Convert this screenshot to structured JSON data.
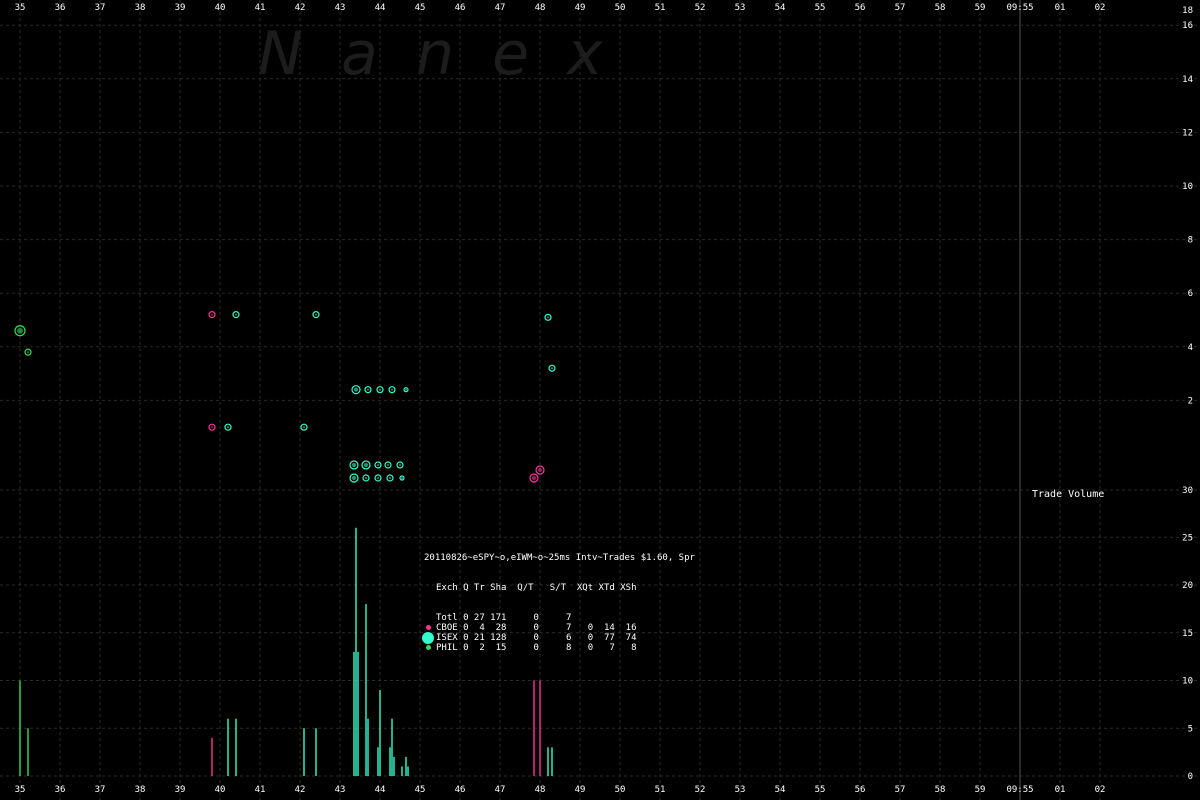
{
  "chart_data": {
    "type": "scatter",
    "watermark": "N  a  n  e  x",
    "x_ticks": [
      "35",
      "36",
      "37",
      "38",
      "39",
      "40",
      "41",
      "42",
      "43",
      "44",
      "45",
      "46",
      "47",
      "48",
      "49",
      "50",
      "51",
      "52",
      "53",
      "54",
      "55",
      "56",
      "57",
      "58",
      "59",
      "09:55",
      "01",
      "02"
    ],
    "marker_x_tick": "09:55",
    "price_panel": {
      "y_ticks": [
        "18",
        "16",
        "14",
        "12",
        "10",
        "8",
        "6",
        "4",
        "2",
        "30"
      ],
      "ylim": [
        30,
        18
      ]
    },
    "volume_panel": {
      "label": "Trade Volume",
      "y_ticks": [
        "30",
        "25",
        "20",
        "15",
        "10",
        "5",
        "0"
      ],
      "ylim": [
        0,
        30
      ]
    },
    "exchanges": [
      {
        "code": "CBOE",
        "color": "#ff3399"
      },
      {
        "code": "ISEX",
        "color": "#33ffcc"
      },
      {
        "code": "PHIL",
        "color": "#33dd55"
      }
    ],
    "trades": [
      {
        "x": 35.0,
        "y": 4.6,
        "ex": "PHIL",
        "size": 5
      },
      {
        "x": 35.2,
        "y": 3.8,
        "ex": "PHIL",
        "size": 3
      },
      {
        "x": 39.8,
        "y": 5.2,
        "ex": "CBOE",
        "size": 3
      },
      {
        "x": 39.8,
        "y": 1.0,
        "ex": "CBOE",
        "size": 3
      },
      {
        "x": 40.2,
        "y": 1.0,
        "ex": "ISEX",
        "size": 3
      },
      {
        "x": 40.4,
        "y": 5.2,
        "ex": "ISEX",
        "size": 3
      },
      {
        "x": 42.1,
        "y": 1.0,
        "ex": "ISEX",
        "size": 3
      },
      {
        "x": 42.4,
        "y": 5.2,
        "ex": "ISEX",
        "size": 3
      },
      {
        "x": 43.4,
        "y": 2.4,
        "ex": "ISEX",
        "size": 4
      },
      {
        "x": 43.7,
        "y": 2.4,
        "ex": "ISEX",
        "size": 3
      },
      {
        "x": 44.0,
        "y": 2.4,
        "ex": "ISEX",
        "size": 3
      },
      {
        "x": 44.3,
        "y": 2.4,
        "ex": "ISEX",
        "size": 3
      },
      {
        "x": 44.65,
        "y": 2.4,
        "ex": "ISEX",
        "size": 2
      },
      {
        "x": 43.35,
        "y": 0.6,
        "ex": "ISEX",
        "size": 4
      },
      {
        "x": 43.65,
        "y": 0.6,
        "ex": "ISEX",
        "size": 4
      },
      {
        "x": 43.95,
        "y": 0.6,
        "ex": "ISEX",
        "size": 3
      },
      {
        "x": 44.2,
        "y": 0.6,
        "ex": "ISEX",
        "size": 3
      },
      {
        "x": 44.5,
        "y": 0.6,
        "ex": "ISEX",
        "size": 3
      },
      {
        "x": 43.35,
        "y": 0.0,
        "ex": "ISEX",
        "size": 4
      },
      {
        "x": 43.65,
        "y": 0.0,
        "ex": "ISEX",
        "size": 3
      },
      {
        "x": 43.95,
        "y": 0.0,
        "ex": "ISEX",
        "size": 3
      },
      {
        "x": 44.25,
        "y": 0.0,
        "ex": "ISEX",
        "size": 3
      },
      {
        "x": 44.55,
        "y": 0.0,
        "ex": "ISEX",
        "size": 2
      },
      {
        "x": 47.85,
        "y": 0.0,
        "ex": "CBOE",
        "size": 4
      },
      {
        "x": 48.0,
        "y": 0.3,
        "ex": "CBOE",
        "size": 4
      },
      {
        "x": 48.2,
        "y": 5.1,
        "ex": "ISEX",
        "size": 3
      },
      {
        "x": 48.3,
        "y": 3.2,
        "ex": "ISEX",
        "size": 3
      }
    ],
    "volume_bars": [
      {
        "x": 35.0,
        "v": 10,
        "ex": "PHIL"
      },
      {
        "x": 35.2,
        "v": 5,
        "ex": "PHIL"
      },
      {
        "x": 39.8,
        "v": 4,
        "ex": "CBOE"
      },
      {
        "x": 40.2,
        "v": 6,
        "ex": "ISEX"
      },
      {
        "x": 40.4,
        "v": 6,
        "ex": "ISEX"
      },
      {
        "x": 42.1,
        "v": 5,
        "ex": "ISEX"
      },
      {
        "x": 42.4,
        "v": 5,
        "ex": "ISEX"
      },
      {
        "x": 43.35,
        "v": 13,
        "ex": "ISEX"
      },
      {
        "x": 43.4,
        "v": 26,
        "ex": "ISEX"
      },
      {
        "x": 43.45,
        "v": 13,
        "ex": "ISEX"
      },
      {
        "x": 43.65,
        "v": 18,
        "ex": "ISEX"
      },
      {
        "x": 43.7,
        "v": 6,
        "ex": "ISEX"
      },
      {
        "x": 43.95,
        "v": 3,
        "ex": "ISEX"
      },
      {
        "x": 44.0,
        "v": 9,
        "ex": "ISEX"
      },
      {
        "x": 44.25,
        "v": 3,
        "ex": "ISEX"
      },
      {
        "x": 44.3,
        "v": 6,
        "ex": "ISEX"
      },
      {
        "x": 44.35,
        "v": 2,
        "ex": "ISEX"
      },
      {
        "x": 44.55,
        "v": 1,
        "ex": "ISEX"
      },
      {
        "x": 44.65,
        "v": 2,
        "ex": "ISEX"
      },
      {
        "x": 44.7,
        "v": 1,
        "ex": "ISEX"
      },
      {
        "x": 47.85,
        "v": 10,
        "ex": "CBOE"
      },
      {
        "x": 48.0,
        "v": 10,
        "ex": "CBOE"
      },
      {
        "x": 48.2,
        "v": 3,
        "ex": "ISEX"
      },
      {
        "x": 48.3,
        "v": 3,
        "ex": "ISEX"
      }
    ]
  },
  "legend": {
    "title": "20110826~eSPY~o,eIWM~o~25ms Intv~Trades $1.60, Spr",
    "header": "Exch Q Tr Sha  Q/T   S/T  XQt XTd XSh",
    "rows": [
      {
        "text": "Totl 0 27 171     0     7",
        "ex": ""
      },
      {
        "text": "CBOE 0  4  28     0     7   0  14  16",
        "ex": "CBOE"
      },
      {
        "text": "ISEX 0 21 128     0     6   0  77  74",
        "ex": "ISEX"
      },
      {
        "text": "PHIL 0  2  15     0     8   0   7   8",
        "ex": "PHIL"
      }
    ]
  }
}
